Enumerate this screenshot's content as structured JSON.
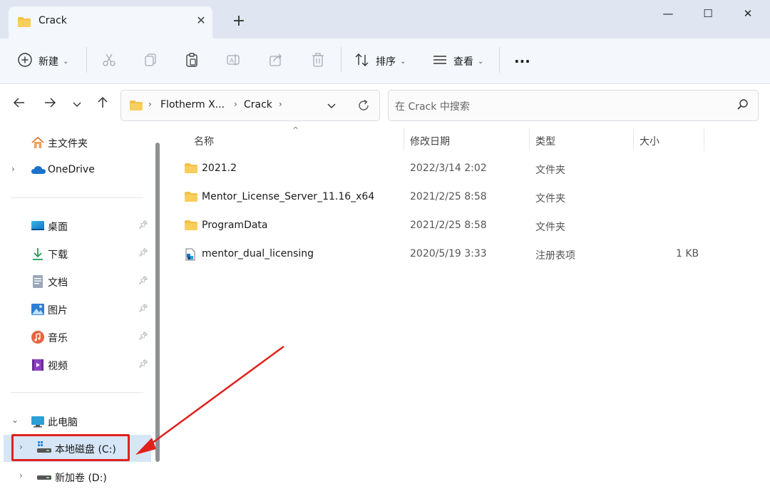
{
  "window": {
    "tab_title": "Crack",
    "tab_close": "✕",
    "new_tab": "+",
    "minimize": "—",
    "maximize": "☐",
    "close": "✕"
  },
  "toolbar": {
    "new_label": "新建",
    "sort_label": "排序",
    "view_label": "查看",
    "more": "···"
  },
  "address": {
    "crumbs": [
      "Flotherm X...",
      "Crack"
    ],
    "search_placeholder": "在 Crack 中搜索"
  },
  "sidebar": {
    "home": "主文件夹",
    "onedrive": "OneDrive",
    "quick": [
      {
        "label": "桌面",
        "icon": "desktop-icon"
      },
      {
        "label": "下载",
        "icon": "download-icon"
      },
      {
        "label": "文档",
        "icon": "documents-icon"
      },
      {
        "label": "图片",
        "icon": "pictures-icon"
      },
      {
        "label": "音乐",
        "icon": "music-icon"
      },
      {
        "label": "视频",
        "icon": "videos-icon"
      }
    ],
    "this_pc": "此电脑",
    "drives": [
      {
        "label": "本地磁盘 (C:)",
        "selected": true
      },
      {
        "label": "新加卷 (D:)",
        "selected": false
      }
    ]
  },
  "columns": {
    "name": "名称",
    "date": "修改日期",
    "type": "类型",
    "size": "大小"
  },
  "files": [
    {
      "name": "2021.2",
      "date": "2022/3/14 2:02",
      "type": "文件夹",
      "size": "",
      "icon": "folder-icon"
    },
    {
      "name": "Mentor_License_Server_11.16_x64",
      "date": "2021/2/25 8:58",
      "type": "文件夹",
      "size": "",
      "icon": "folder-icon"
    },
    {
      "name": "ProgramData",
      "date": "2021/2/25 8:58",
      "type": "文件夹",
      "size": "",
      "icon": "folder-icon"
    },
    {
      "name": "mentor_dual_licensing",
      "date": "2020/5/19 3:33",
      "type": "注册表项",
      "size": "1 KB",
      "icon": "registry-file-icon"
    }
  ],
  "colors": {
    "accent": "#1a73c9",
    "folder": "#f4c048",
    "annotation": "#e0211d",
    "titlebar": "#dfe6f2",
    "selection": "#d6e6f7"
  }
}
